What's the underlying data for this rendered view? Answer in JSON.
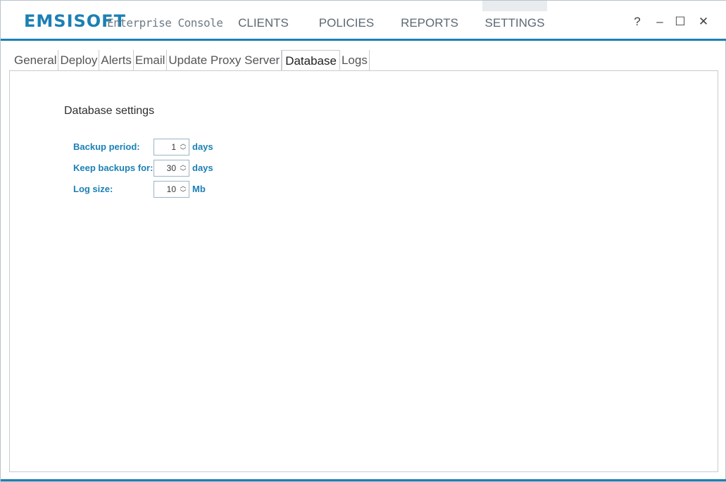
{
  "app": {
    "logo_bold": "EMSISOFT",
    "subtitle": "Enterprise Console"
  },
  "nav": [
    "CLIENTS",
    "POLICIES",
    "REPORTS",
    "SETTINGS"
  ],
  "window": {
    "help": "?",
    "minimize": "–",
    "maximize": "☐",
    "close": "✕"
  },
  "tabs": [
    "General",
    "Deploy",
    "Alerts",
    "Email",
    "Update Proxy Server",
    "Database",
    "Logs"
  ],
  "active_tab": "Database",
  "database": {
    "title": "Database settings",
    "rows": [
      {
        "label": "Backup period:",
        "value": "1",
        "unit": "days"
      },
      {
        "label": "Keep backups for:",
        "value": "30",
        "unit": "days"
      },
      {
        "label": "Log size:",
        "value": "10",
        "unit": "Mb"
      }
    ]
  },
  "colors": {
    "accent": "#1b80b5",
    "text": "#333333"
  }
}
